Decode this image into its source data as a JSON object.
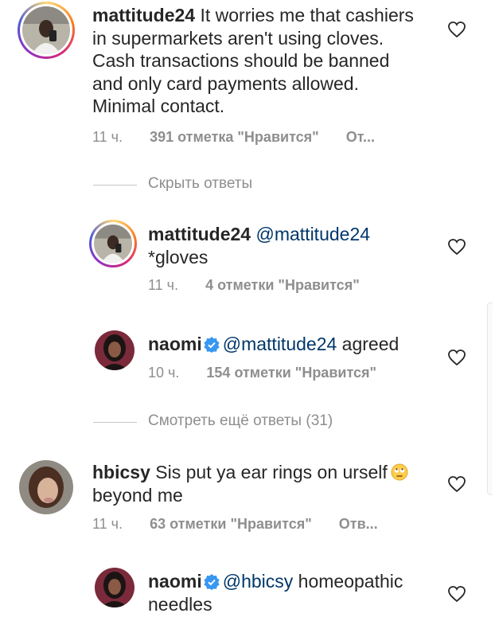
{
  "colors": {
    "text": "#262626",
    "muted": "#8e8e8e",
    "mention": "#00376b",
    "verified": "#3897f0"
  },
  "comments": [
    {
      "username": "mattitude24",
      "text_lines": [
        "It worries me that cashiers",
        "in supermarkets aren't using cloves.",
        "Cash transactions should be banned",
        "and only card payments allowed.",
        "Minimal contact."
      ],
      "first_line_suffix": "It worries me that cashiers",
      "time": "11 ч.",
      "likes": "391 отметка \"Нравится\"",
      "reply": "От...",
      "avatar_icon": "profile-avatar-icon",
      "has_story_ring": true
    },
    {
      "username": "mattitude24",
      "mention": "@mattitude24",
      "text": "*gloves",
      "time": "11 ч.",
      "likes": "4 отметки \"Нравится\"",
      "has_story_ring": true
    },
    {
      "username": "naomi",
      "verified": true,
      "mention": "@mattitude24",
      "text": "agreed",
      "time": "10 ч.",
      "likes": "154 отметки \"Нравится\""
    },
    {
      "username": "hbicsy",
      "text_line1": "Sis put ya ear rings on urself",
      "text_line2": "beyond me",
      "emoji_icon": "eye-roll-emoji-icon",
      "time": "11 ч.",
      "likes": "63 отметки \"Нравится\"",
      "reply": "Отв..."
    },
    {
      "username": "naomi",
      "verified": true,
      "mention": "@hbicsy",
      "text_line1": "homeopathic",
      "text_line2": "needles"
    }
  ],
  "threads": {
    "hide_replies": "Скрыть ответы",
    "view_more": "Смотреть ещё ответы (31)"
  }
}
